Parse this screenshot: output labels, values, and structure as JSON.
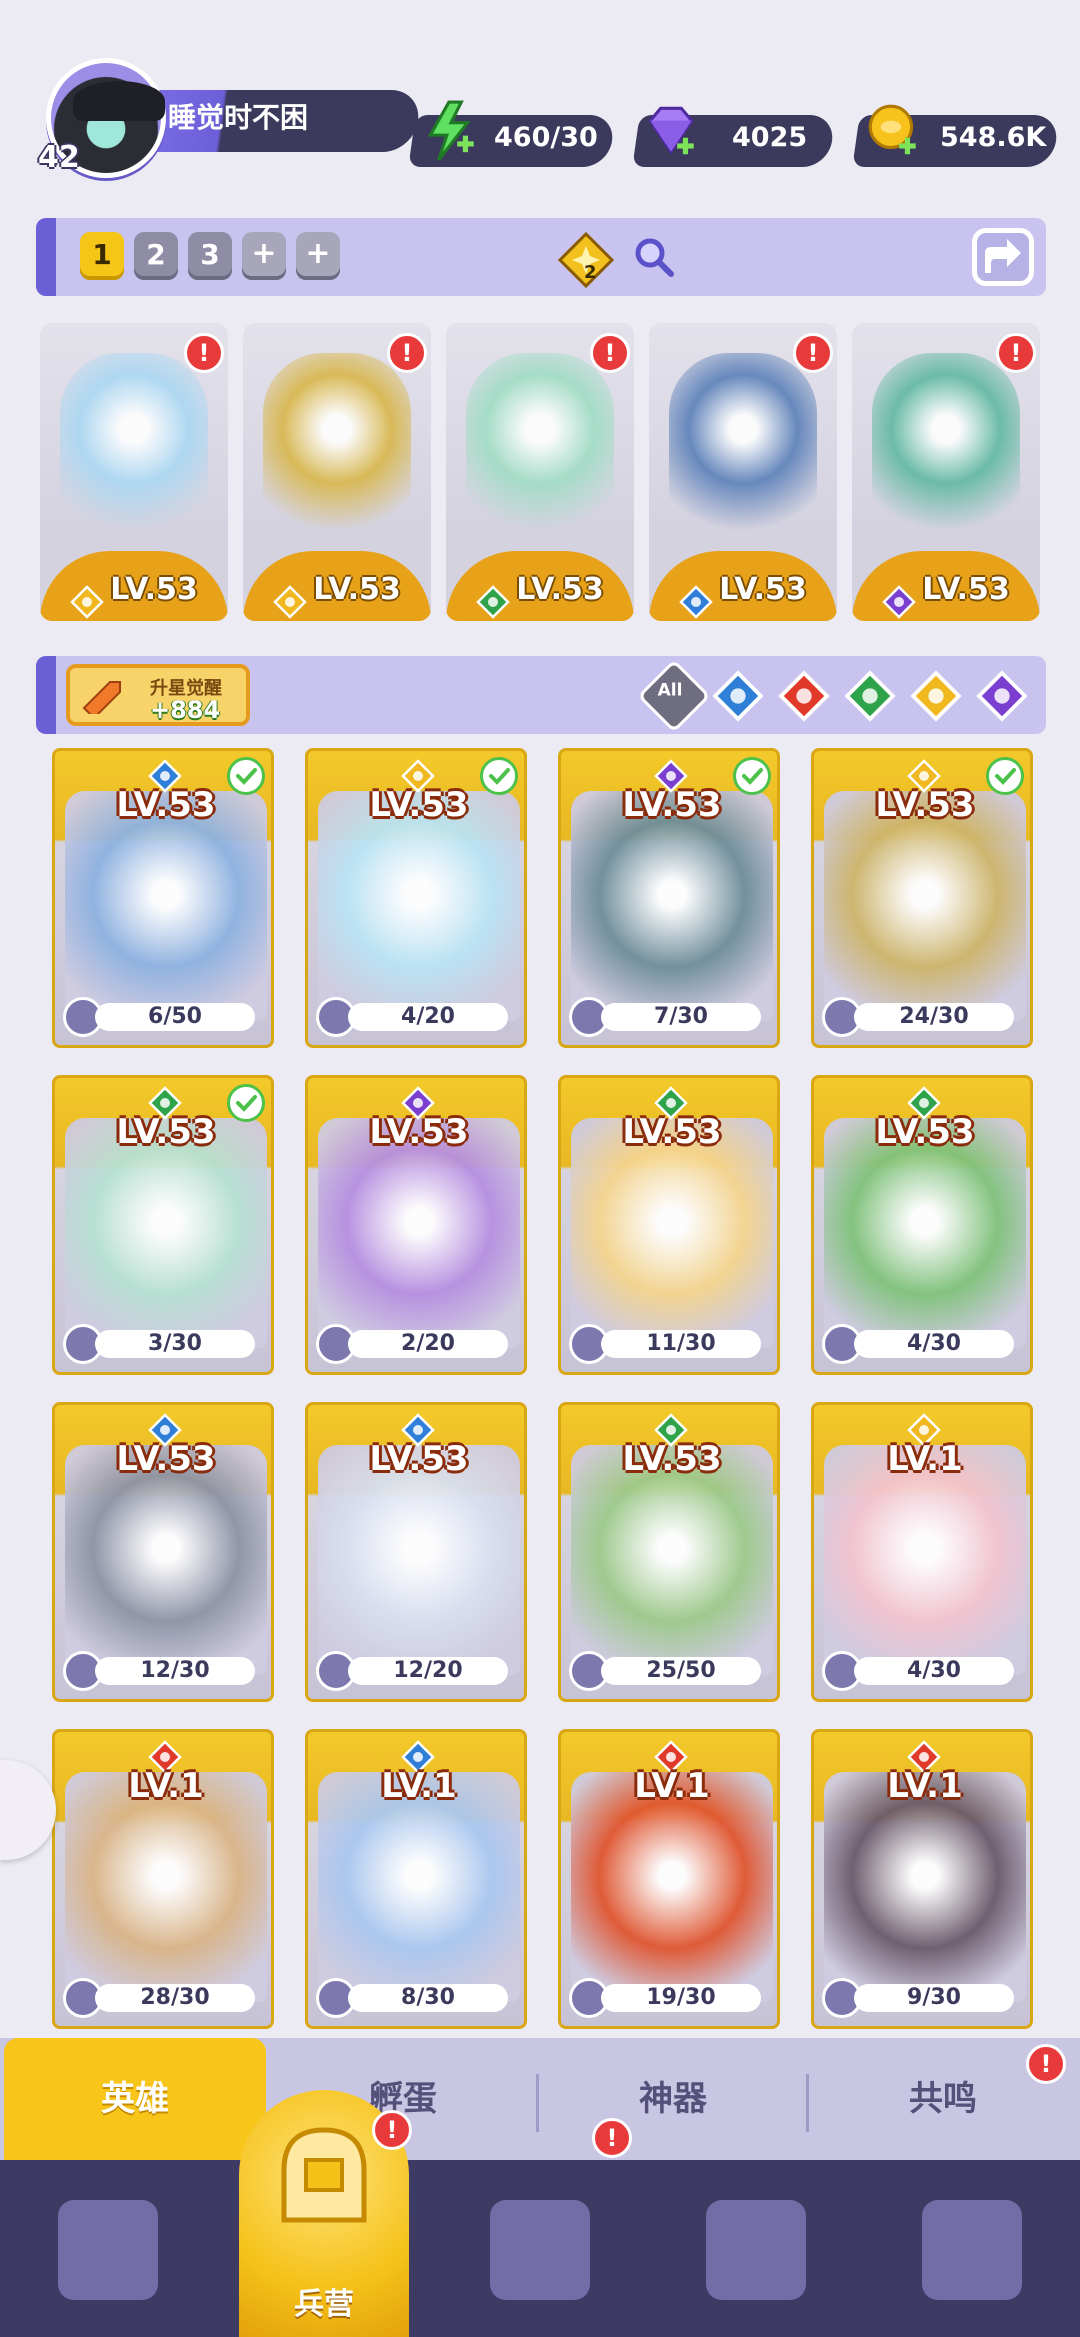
{
  "player": {
    "level": "42",
    "name": "睡觉时不困"
  },
  "resources": {
    "energy": "460/30",
    "gems": "4025",
    "gold": "548.6K"
  },
  "team": {
    "tabs": [
      "1",
      "2",
      "3"
    ],
    "active_tab": "1",
    "add_symbol": "+",
    "badge_count": "2",
    "members": [
      {
        "level": "LV.53",
        "element": "light",
        "color": "#a9d7f2"
      },
      {
        "level": "LV.53",
        "element": "light",
        "color": "#d8b648"
      },
      {
        "level": "LV.53",
        "element": "wind",
        "color": "#9fdcc4"
      },
      {
        "level": "LV.53",
        "element": "water",
        "color": "#5a7fb8"
      },
      {
        "level": "LV.53",
        "element": "dark",
        "color": "#5fb8a0"
      }
    ]
  },
  "filters": {
    "awaken_title": "升星觉醒",
    "awaken_count": "+884",
    "all_label": "All",
    "elements": [
      "water",
      "fire",
      "wind",
      "light",
      "dark"
    ]
  },
  "heroes": [
    {
      "level": "LV.53",
      "element": "water",
      "progress": "6/50",
      "checked": true,
      "color": "#8db1e0"
    },
    {
      "level": "LV.53",
      "element": "light",
      "progress": "4/20",
      "checked": true,
      "color": "#b9e3f4"
    },
    {
      "level": "LV.53",
      "element": "dark",
      "progress": "7/30",
      "checked": true,
      "color": "#6d8d9a"
    },
    {
      "level": "LV.53",
      "element": "light",
      "progress": "24/30",
      "checked": true,
      "color": "#cdb46a"
    },
    {
      "level": "LV.53",
      "element": "wind",
      "progress": "3/30",
      "checked": true,
      "color": "#b6e0d2"
    },
    {
      "level": "LV.53",
      "element": "dark",
      "progress": "2/20",
      "checked": false,
      "color": "#b68ee0"
    },
    {
      "level": "LV.53",
      "element": "wind",
      "progress": "11/30",
      "checked": false,
      "color": "#f4d48d"
    },
    {
      "level": "LV.53",
      "element": "wind",
      "progress": "4/30",
      "checked": false,
      "color": "#7fc27a"
    },
    {
      "level": "LV.53",
      "element": "water",
      "progress": "12/30",
      "checked": false,
      "color": "#8d93a6"
    },
    {
      "level": "LV.53",
      "element": "water",
      "progress": "12/20",
      "checked": false,
      "color": "#d8dff0"
    },
    {
      "level": "LV.53",
      "element": "wind",
      "progress": "25/50",
      "checked": false,
      "color": "#9cc98a"
    },
    {
      "level": "LV.1",
      "element": "light",
      "progress": "4/30",
      "checked": false,
      "color": "#f2c3cf"
    },
    {
      "level": "LV.1",
      "element": "fire",
      "progress": "28/30",
      "checked": false,
      "color": "#d9b487"
    },
    {
      "level": "LV.1",
      "element": "water",
      "progress": "8/30",
      "checked": false,
      "color": "#a9c7ef"
    },
    {
      "level": "LV.1",
      "element": "fire",
      "progress": "19/30",
      "checked": false,
      "color": "#e0552f"
    },
    {
      "level": "LV.1",
      "element": "fire",
      "progress": "9/30",
      "checked": false,
      "color": "#6a5a6a"
    }
  ],
  "subtabs": [
    "英雄",
    "孵蛋",
    "神器",
    "共鸣"
  ],
  "nav": {
    "active_label": "兵营"
  },
  "alert_symbol": "!",
  "colors": {
    "light": "#f0b81e",
    "wind": "#2fa34a",
    "water": "#2f7fd8",
    "dark": "#7b3fd0",
    "fire": "#e13a2a",
    "accent": "#f8c51a",
    "nav_bg": "#3d3a63"
  }
}
